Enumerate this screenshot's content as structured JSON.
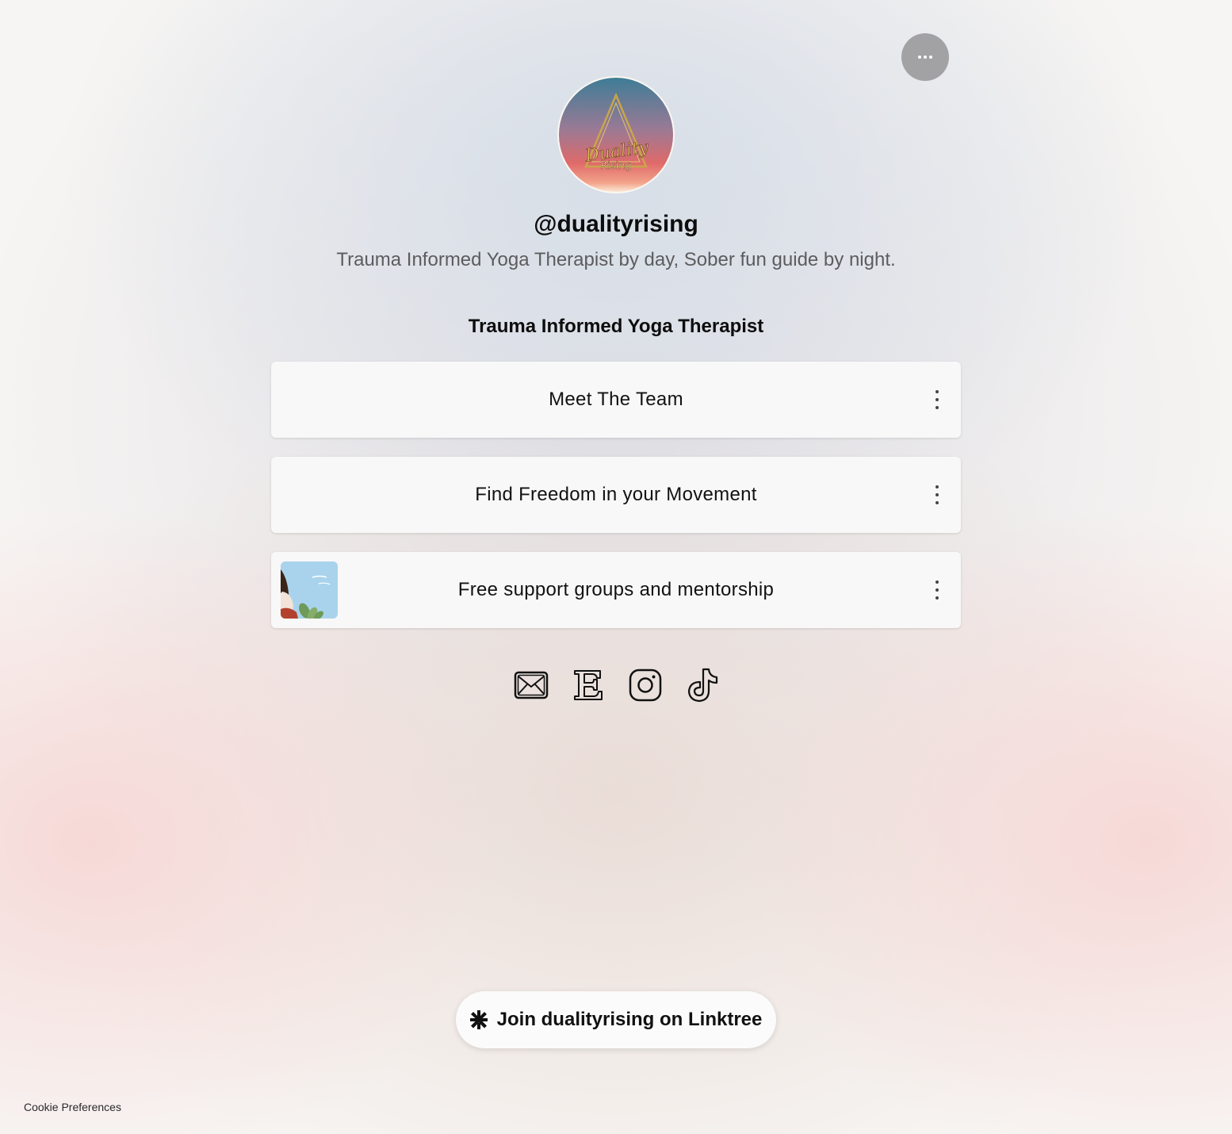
{
  "header": {
    "more_button_icon": "more-horizontal-icon"
  },
  "profile": {
    "avatar_text_line1": "Duality",
    "avatar_text_line2": "Rising",
    "username": "@dualityrising",
    "bio": "Trauma Informed Yoga Therapist by day, Sober fun guide by night."
  },
  "links": {
    "section_header": "Trauma Informed Yoga Therapist",
    "items": [
      {
        "label": "Meet The Team",
        "has_thumbnail": false
      },
      {
        "label": "Find Freedom in your Movement",
        "has_thumbnail": false
      },
      {
        "label": "Free support groups and mentorship",
        "has_thumbnail": true
      }
    ],
    "item_menu_icon": "more-vertical-icon"
  },
  "socials": [
    {
      "icon": "email-icon"
    },
    {
      "icon": "etsy-icon"
    },
    {
      "icon": "instagram-icon"
    },
    {
      "icon": "tiktok-icon"
    }
  ],
  "footer": {
    "join_icon": "linktree-asterisk-icon",
    "join_label": "Join dualityrising on Linktree",
    "cookie_label": "Cookie Preferences"
  },
  "colors": {
    "card_background": "#f8f8f8",
    "more_button_background": "#a2a2a4",
    "text_primary": "#111111",
    "text_secondary": "#5c5c5e"
  }
}
